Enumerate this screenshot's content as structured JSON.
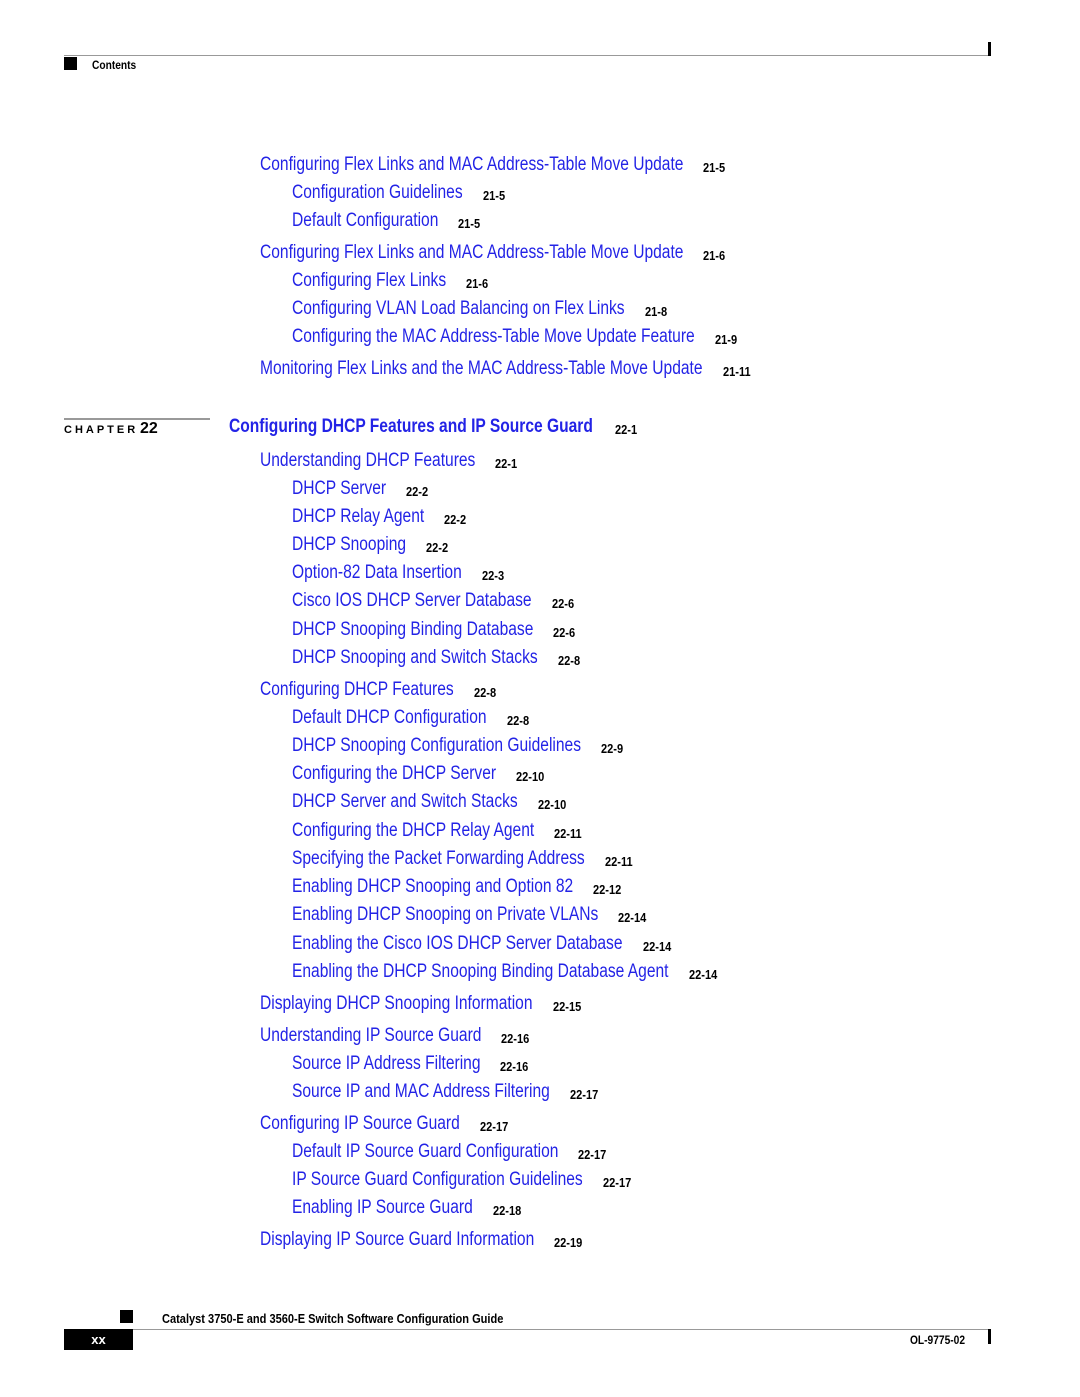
{
  "header": {
    "section": "Contents"
  },
  "chapter": {
    "label": "CHAPTER",
    "number": "22",
    "title": "Configuring DHCP Features and IP Source Guard",
    "page": "22-1"
  },
  "entries_before": [
    {
      "level": 1,
      "title": "Configuring Flex Links and MAC Address-Table Move Update",
      "page": "21-5"
    },
    {
      "level": 2,
      "title": "Configuration Guidelines",
      "page": "21-5"
    },
    {
      "level": 2,
      "title": "Default Configuration",
      "page": "21-5"
    },
    {
      "level": 1,
      "title": "Configuring Flex Links and MAC Address-Table Move Update",
      "page": "21-6"
    },
    {
      "level": 2,
      "title": "Configuring Flex Links",
      "page": "21-6"
    },
    {
      "level": 2,
      "title": "Configuring VLAN Load Balancing on Flex Links",
      "page": "21-8"
    },
    {
      "level": 2,
      "title": "Configuring the MAC Address-Table Move Update Feature",
      "page": "21-9"
    },
    {
      "level": 1,
      "title": "Monitoring Flex Links and the MAC Address-Table Move Update",
      "page": "21-11"
    }
  ],
  "entries_after": [
    {
      "level": 1,
      "title": "Understanding DHCP Features",
      "page": "22-1"
    },
    {
      "level": 2,
      "title": "DHCP Server",
      "page": "22-2"
    },
    {
      "level": 2,
      "title": "DHCP Relay Agent",
      "page": "22-2"
    },
    {
      "level": 2,
      "title": "DHCP Snooping",
      "page": "22-2"
    },
    {
      "level": 2,
      "title": "Option-82 Data Insertion",
      "page": "22-3"
    },
    {
      "level": 2,
      "title": "Cisco IOS DHCP Server Database",
      "page": "22-6"
    },
    {
      "level": 2,
      "title": "DHCP Snooping Binding Database",
      "page": "22-6"
    },
    {
      "level": 2,
      "title": "DHCP Snooping and Switch Stacks",
      "page": "22-8"
    },
    {
      "level": 1,
      "title": "Configuring DHCP Features",
      "page": "22-8"
    },
    {
      "level": 2,
      "title": "Default DHCP Configuration",
      "page": "22-8"
    },
    {
      "level": 2,
      "title": "DHCP Snooping Configuration Guidelines",
      "page": "22-9"
    },
    {
      "level": 2,
      "title": "Configuring the DHCP Server",
      "page": "22-10"
    },
    {
      "level": 2,
      "title": "DHCP Server and Switch Stacks",
      "page": "22-10"
    },
    {
      "level": 2,
      "title": "Configuring the DHCP Relay Agent",
      "page": "22-11"
    },
    {
      "level": 2,
      "title": "Specifying the Packet Forwarding Address",
      "page": "22-11"
    },
    {
      "level": 2,
      "title": "Enabling DHCP Snooping and Option 82",
      "page": "22-12"
    },
    {
      "level": 2,
      "title": "Enabling DHCP Snooping on Private VLANs",
      "page": "22-14"
    },
    {
      "level": 2,
      "title": "Enabling the Cisco IOS DHCP Server Database",
      "page": "22-14"
    },
    {
      "level": 2,
      "title": "Enabling the DHCP Snooping Binding Database Agent",
      "page": "22-14"
    },
    {
      "level": 1,
      "title": "Displaying DHCP Snooping Information",
      "page": "22-15"
    },
    {
      "level": 1,
      "title": "Understanding IP Source Guard",
      "page": "22-16"
    },
    {
      "level": 2,
      "title": "Source IP Address Filtering",
      "page": "22-16"
    },
    {
      "level": 2,
      "title": "Source IP and MAC Address Filtering",
      "page": "22-17"
    },
    {
      "level": 1,
      "title": "Configuring IP Source Guard",
      "page": "22-17"
    },
    {
      "level": 2,
      "title": "Default IP Source Guard Configuration",
      "page": "22-17"
    },
    {
      "level": 2,
      "title": "IP Source Guard Configuration Guidelines",
      "page": "22-17"
    },
    {
      "level": 2,
      "title": "Enabling IP Source Guard",
      "page": "22-18"
    },
    {
      "level": 1,
      "title": "Displaying IP Source Guard Information",
      "page": "22-19"
    }
  ],
  "footer": {
    "guide_title": "Catalyst 3750-E and 3560-E Switch Software Configuration Guide",
    "page_number": "xx",
    "doc_number": "OL-9775-02"
  },
  "colors": {
    "link": "#2323e6",
    "text": "#000000",
    "rule": "#999999"
  }
}
